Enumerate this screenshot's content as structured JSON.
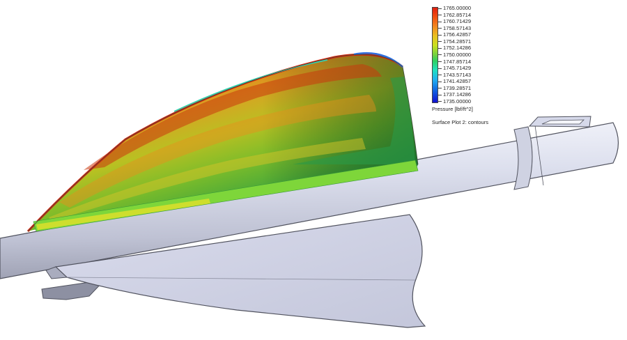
{
  "legend": {
    "ticks": [
      "1765.00000",
      "1762.85714",
      "1760.71429",
      "1758.57143",
      "1756.42857",
      "1754.28571",
      "1752.14286",
      "1750.00000",
      "1747.85714",
      "1745.71429",
      "1743.57143",
      "1741.42857",
      "1739.28571",
      "1737.14286",
      "1735.00000"
    ],
    "quantity_label": "Pressure [lbf/ft^2]",
    "plot_name": "Surface Plot 2: contours",
    "colors": {
      "max": "#e02010",
      "high": "#f08820",
      "mid_high": "#e8c020",
      "mid": "#70d040",
      "mid_low": "#20e0c0",
      "low": "#20b0f0",
      "min": "#1010d0"
    }
  },
  "model": {
    "body_color": "#d6d9ea",
    "edge_color": "#50525e"
  }
}
